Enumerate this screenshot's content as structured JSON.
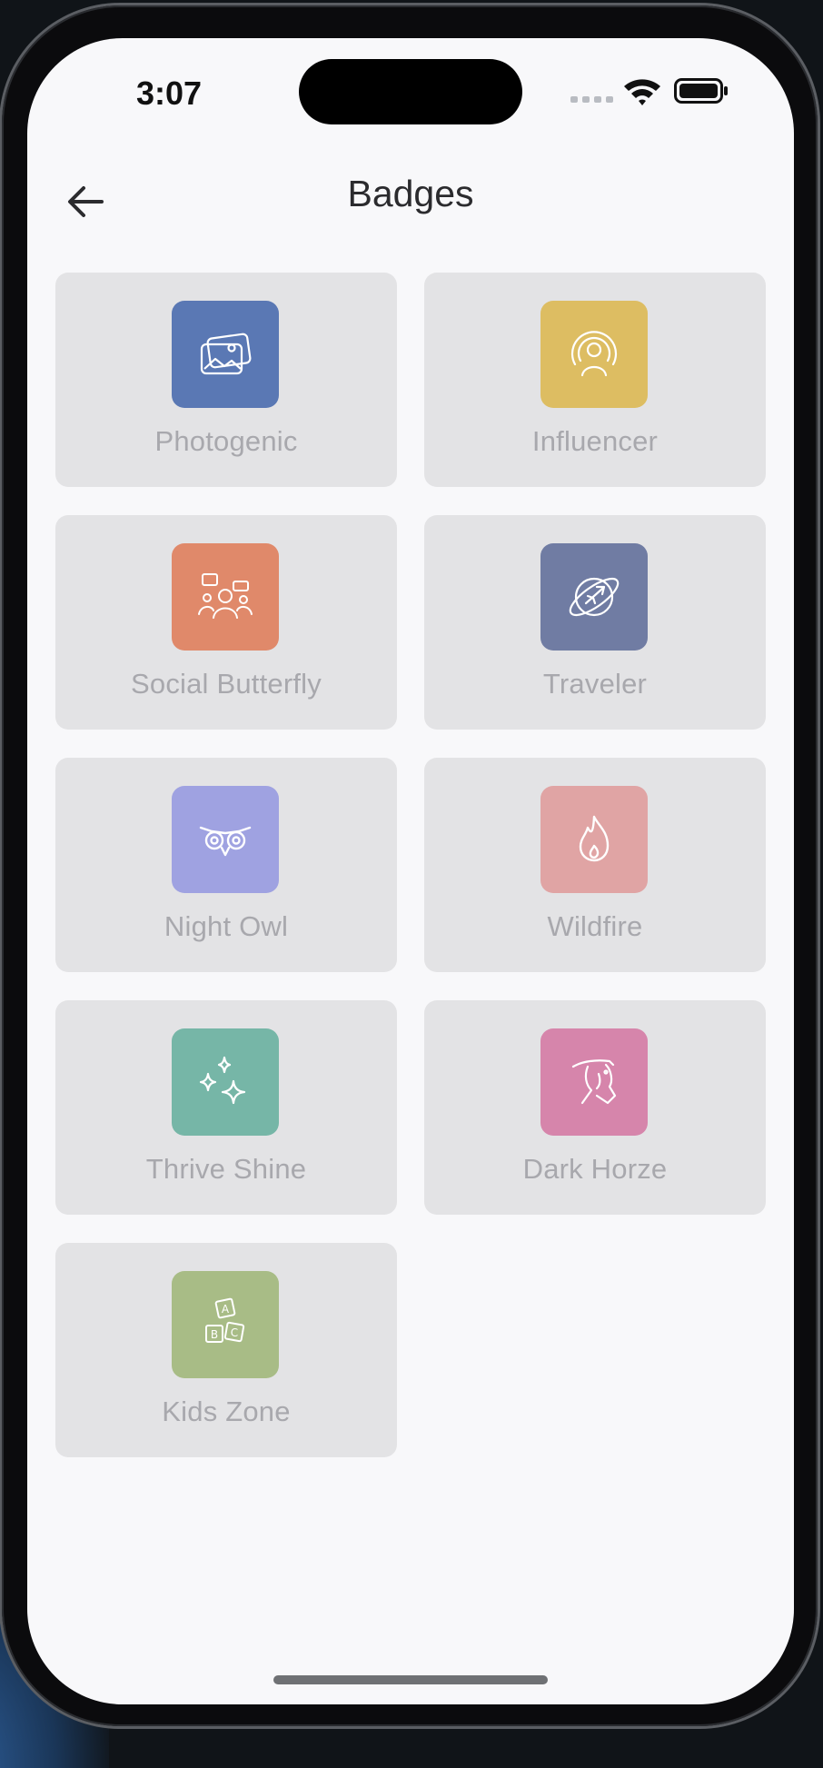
{
  "status_bar": {
    "time": "3:07"
  },
  "header": {
    "title": "Badges",
    "back_icon": "arrow-left-icon"
  },
  "colors": {
    "photogenic": "#5a78b4",
    "influencer": "#ddbd62",
    "social_butterfly": "#e0896a",
    "traveler": "#707ca3",
    "night_owl": "#9fa2e1",
    "wildfire": "#e0a4a4",
    "thrive_shine": "#76b6a7",
    "dark_horze": "#d685ab",
    "kids_zone": "#a8bc86"
  },
  "badges": [
    {
      "label": "Photogenic",
      "icon": "photos-icon"
    },
    {
      "label": "Influencer",
      "icon": "broadcast-person-icon"
    },
    {
      "label": "Social Butterfly",
      "icon": "people-chat-icon"
    },
    {
      "label": "Traveler",
      "icon": "globe-plane-icon"
    },
    {
      "label": "Night Owl",
      "icon": "owl-icon"
    },
    {
      "label": "Wildfire",
      "icon": "flame-icon"
    },
    {
      "label": "Thrive Shine",
      "icon": "sparkles-icon"
    },
    {
      "label": "Dark Horze",
      "icon": "horse-head-icon"
    },
    {
      "label": "Kids Zone",
      "icon": "abc-blocks-icon"
    }
  ]
}
